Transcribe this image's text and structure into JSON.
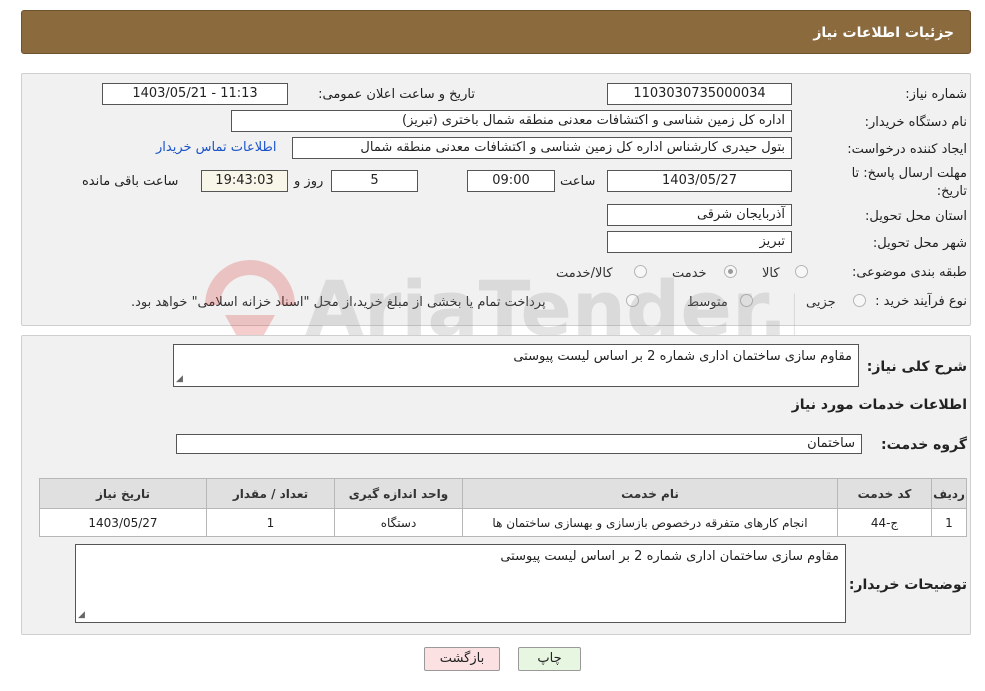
{
  "header": {
    "title": "جزئیات اطلاعات نیاز"
  },
  "fields": {
    "need_number_label": "شماره نیاز:",
    "need_number": "1103030735000034",
    "announce_label": "تاریخ و ساعت اعلان عمومی:",
    "announce_value": "1403/05/21 - 11:13",
    "buyer_org_label": "نام دستگاه خریدار:",
    "buyer_org": "اداره کل زمین شناسی و اکتشافات معدنی منطقه شمال باختری (تبریز)",
    "creator_label": "ایجاد کننده درخواست:",
    "creator": "بتول  حیدری کارشناس اداره کل زمین شناسی و اکتشافات معدنی منطقه شمال",
    "contact_link": "اطلاعات تماس خریدار",
    "deadline_label": "مهلت ارسال پاسخ: تا تاریخ:",
    "deadline_label_line1": "مهلت ارسال پاسخ: تا",
    "deadline_label_line2": "تاریخ:",
    "deadline_date": "1403/05/27",
    "time_label": "ساعت",
    "deadline_time": "09:00",
    "days_value": "5",
    "days_label": "روز و",
    "remaining_time": "19:43:03",
    "remaining_label": "ساعت باقی مانده",
    "province_label": "استان محل تحویل:",
    "province": "آذربایجان شرقی",
    "city_label": "شهر محل تحویل:",
    "city": "تبریز",
    "category_label": "طبقه بندی موضوعی:",
    "category_options": [
      {
        "label": "کالا",
        "checked": false
      },
      {
        "label": "خدمت",
        "checked": true
      },
      {
        "label": "کالا/خدمت",
        "checked": false
      }
    ],
    "process_label": "نوع فرآیند خرید :",
    "process_options": [
      {
        "label": "جزیی",
        "checked": false
      },
      {
        "label": "متوسط",
        "checked": false
      }
    ],
    "process_note": "پرداخت تمام یا بخشی از مبلغ خرید،از محل \"اسناد خزانه اسلامی\" خواهد بود."
  },
  "summary": {
    "label": "شرح کلی نیاز:",
    "value": "مقاوم سازی ساختمان اداری شماره 2 بر اساس لیست پیوستی"
  },
  "services": {
    "section_title": "اطلاعات خدمات مورد نیاز",
    "group_label": "گروه خدمت:",
    "group_value": "ساختمان",
    "table": {
      "headers": [
        "ردیف",
        "کد خدمت",
        "نام خدمت",
        "واحد اندازه گیری",
        "تعداد / مقدار",
        "تاریخ نیاز"
      ],
      "rows": [
        [
          "1",
          "ج-44",
          "انجام کارهای متفرقه درخصوص بازسازی و بهسازی ساختمان ها",
          "دستگاه",
          "1",
          "1403/05/27"
        ]
      ]
    }
  },
  "buyer_notes": {
    "label": "توضیحات خریدار:",
    "value": "مقاوم سازی ساختمان اداری شماره 2 بر اساس لیست پیوستی"
  },
  "buttons": {
    "back": "بازگشت",
    "print": "چاپ"
  },
  "watermark": {
    "text": "AriaTender.net"
  }
}
